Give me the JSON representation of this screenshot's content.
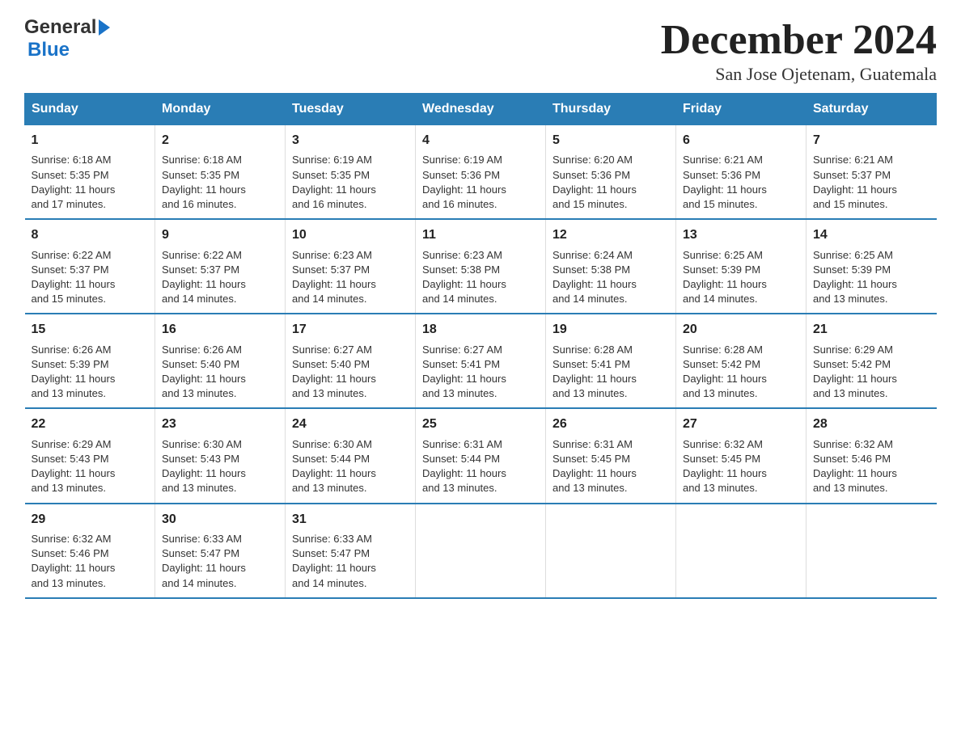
{
  "logo": {
    "general": "General",
    "blue": "Blue"
  },
  "title": "December 2024",
  "subtitle": "San Jose Ojetenam, Guatemala",
  "days_of_week": [
    "Sunday",
    "Monday",
    "Tuesday",
    "Wednesday",
    "Thursday",
    "Friday",
    "Saturday"
  ],
  "weeks": [
    [
      {
        "day": "1",
        "sunrise": "6:18 AM",
        "sunset": "5:35 PM",
        "daylight": "11 hours and 17 minutes."
      },
      {
        "day": "2",
        "sunrise": "6:18 AM",
        "sunset": "5:35 PM",
        "daylight": "11 hours and 16 minutes."
      },
      {
        "day": "3",
        "sunrise": "6:19 AM",
        "sunset": "5:35 PM",
        "daylight": "11 hours and 16 minutes."
      },
      {
        "day": "4",
        "sunrise": "6:19 AM",
        "sunset": "5:36 PM",
        "daylight": "11 hours and 16 minutes."
      },
      {
        "day": "5",
        "sunrise": "6:20 AM",
        "sunset": "5:36 PM",
        "daylight": "11 hours and 15 minutes."
      },
      {
        "day": "6",
        "sunrise": "6:21 AM",
        "sunset": "5:36 PM",
        "daylight": "11 hours and 15 minutes."
      },
      {
        "day": "7",
        "sunrise": "6:21 AM",
        "sunset": "5:37 PM",
        "daylight": "11 hours and 15 minutes."
      }
    ],
    [
      {
        "day": "8",
        "sunrise": "6:22 AM",
        "sunset": "5:37 PM",
        "daylight": "11 hours and 15 minutes."
      },
      {
        "day": "9",
        "sunrise": "6:22 AM",
        "sunset": "5:37 PM",
        "daylight": "11 hours and 14 minutes."
      },
      {
        "day": "10",
        "sunrise": "6:23 AM",
        "sunset": "5:37 PM",
        "daylight": "11 hours and 14 minutes."
      },
      {
        "day": "11",
        "sunrise": "6:23 AM",
        "sunset": "5:38 PM",
        "daylight": "11 hours and 14 minutes."
      },
      {
        "day": "12",
        "sunrise": "6:24 AM",
        "sunset": "5:38 PM",
        "daylight": "11 hours and 14 minutes."
      },
      {
        "day": "13",
        "sunrise": "6:25 AM",
        "sunset": "5:39 PM",
        "daylight": "11 hours and 14 minutes."
      },
      {
        "day": "14",
        "sunrise": "6:25 AM",
        "sunset": "5:39 PM",
        "daylight": "11 hours and 13 minutes."
      }
    ],
    [
      {
        "day": "15",
        "sunrise": "6:26 AM",
        "sunset": "5:39 PM",
        "daylight": "11 hours and 13 minutes."
      },
      {
        "day": "16",
        "sunrise": "6:26 AM",
        "sunset": "5:40 PM",
        "daylight": "11 hours and 13 minutes."
      },
      {
        "day": "17",
        "sunrise": "6:27 AM",
        "sunset": "5:40 PM",
        "daylight": "11 hours and 13 minutes."
      },
      {
        "day": "18",
        "sunrise": "6:27 AM",
        "sunset": "5:41 PM",
        "daylight": "11 hours and 13 minutes."
      },
      {
        "day": "19",
        "sunrise": "6:28 AM",
        "sunset": "5:41 PM",
        "daylight": "11 hours and 13 minutes."
      },
      {
        "day": "20",
        "sunrise": "6:28 AM",
        "sunset": "5:42 PM",
        "daylight": "11 hours and 13 minutes."
      },
      {
        "day": "21",
        "sunrise": "6:29 AM",
        "sunset": "5:42 PM",
        "daylight": "11 hours and 13 minutes."
      }
    ],
    [
      {
        "day": "22",
        "sunrise": "6:29 AM",
        "sunset": "5:43 PM",
        "daylight": "11 hours and 13 minutes."
      },
      {
        "day": "23",
        "sunrise": "6:30 AM",
        "sunset": "5:43 PM",
        "daylight": "11 hours and 13 minutes."
      },
      {
        "day": "24",
        "sunrise": "6:30 AM",
        "sunset": "5:44 PM",
        "daylight": "11 hours and 13 minutes."
      },
      {
        "day": "25",
        "sunrise": "6:31 AM",
        "sunset": "5:44 PM",
        "daylight": "11 hours and 13 minutes."
      },
      {
        "day": "26",
        "sunrise": "6:31 AM",
        "sunset": "5:45 PM",
        "daylight": "11 hours and 13 minutes."
      },
      {
        "day": "27",
        "sunrise": "6:32 AM",
        "sunset": "5:45 PM",
        "daylight": "11 hours and 13 minutes."
      },
      {
        "day": "28",
        "sunrise": "6:32 AM",
        "sunset": "5:46 PM",
        "daylight": "11 hours and 13 minutes."
      }
    ],
    [
      {
        "day": "29",
        "sunrise": "6:32 AM",
        "sunset": "5:46 PM",
        "daylight": "11 hours and 13 minutes."
      },
      {
        "day": "30",
        "sunrise": "6:33 AM",
        "sunset": "5:47 PM",
        "daylight": "11 hours and 14 minutes."
      },
      {
        "day": "31",
        "sunrise": "6:33 AM",
        "sunset": "5:47 PM",
        "daylight": "11 hours and 14 minutes."
      },
      null,
      null,
      null,
      null
    ]
  ],
  "labels": {
    "sunrise": "Sunrise:",
    "sunset": "Sunset:",
    "daylight": "Daylight:"
  }
}
